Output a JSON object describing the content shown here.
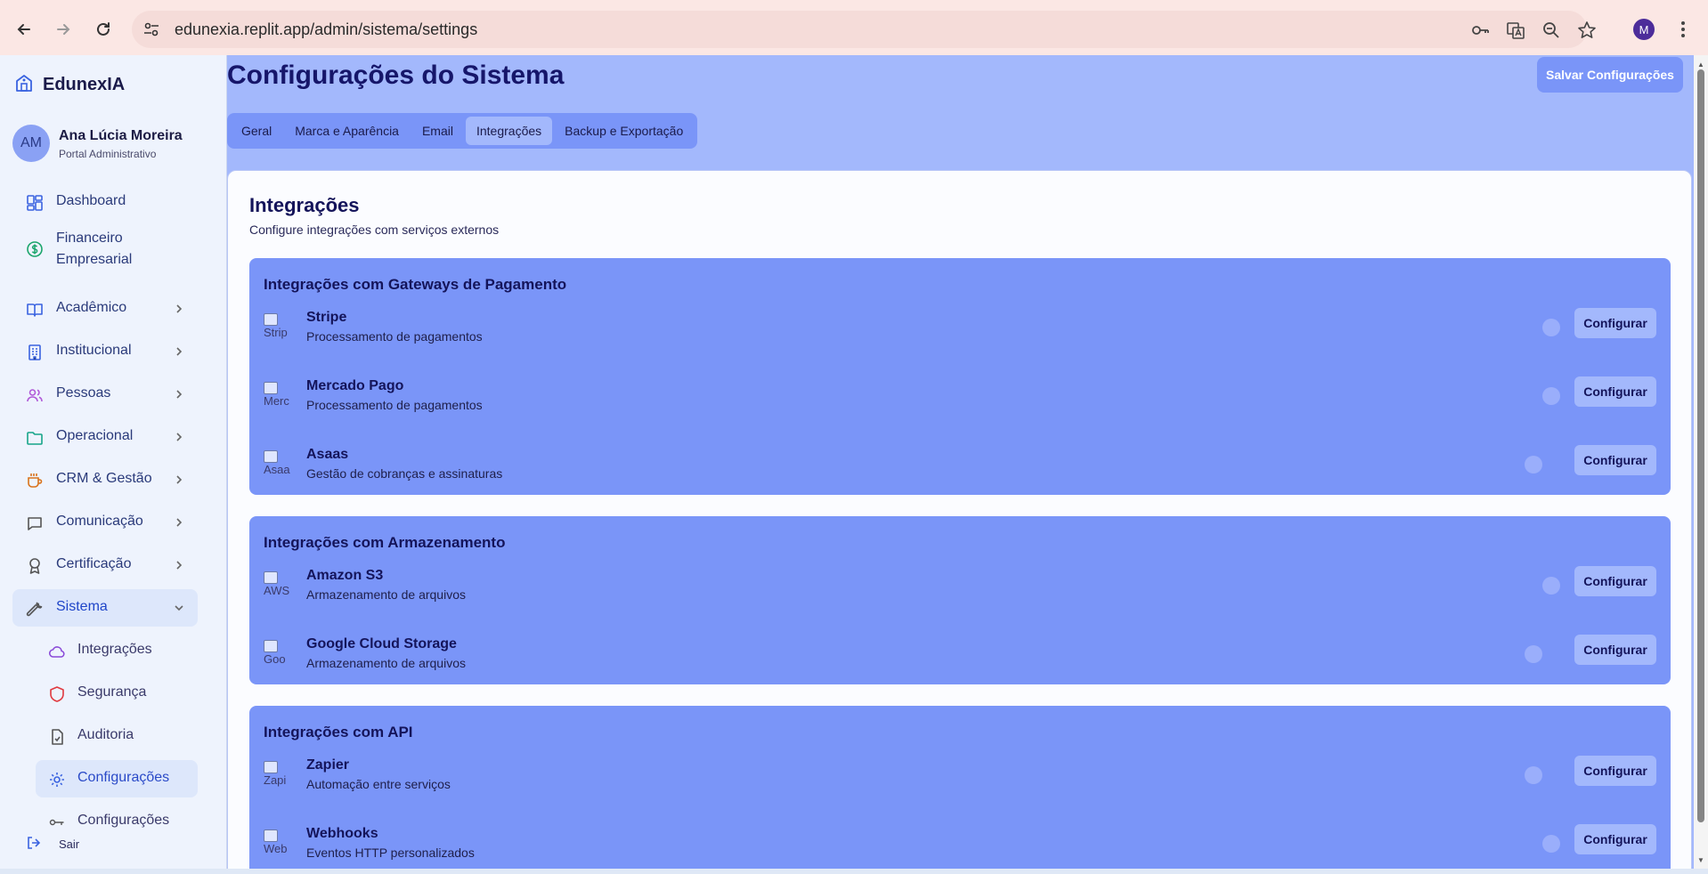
{
  "browser": {
    "url": "edunexia.replit.app/admin/sistema/settings",
    "profile_initial": "M"
  },
  "sidebar": {
    "brand": "EdunexIA",
    "user": {
      "initials": "AM",
      "name": "Ana Lúcia Moreira",
      "role": "Portal Administrativo"
    },
    "items": [
      {
        "label": "Dashboard",
        "icon": "dashboard-icon"
      },
      {
        "label": "Financeiro",
        "label2": "Empresarial",
        "icon": "dollar-icon"
      },
      {
        "label": "Acadêmico",
        "icon": "book-icon"
      },
      {
        "label": "Institucional",
        "icon": "building-icon"
      },
      {
        "label": "Pessoas",
        "icon": "users-icon"
      },
      {
        "label": "Operacional",
        "icon": "folder-icon"
      },
      {
        "label": "CRM & Gestão",
        "icon": "coffee-icon"
      },
      {
        "label": "Comunicação",
        "icon": "message-icon"
      },
      {
        "label": "Certificação",
        "icon": "award-icon"
      },
      {
        "label": "Sistema",
        "icon": "wrench-icon"
      }
    ],
    "sub_items": [
      {
        "label": "Integrações",
        "icon": "cloud-icon"
      },
      {
        "label": "Segurança",
        "icon": "shield-icon"
      },
      {
        "label": "Auditoria",
        "icon": "file-check-icon"
      },
      {
        "label": "Configurações",
        "icon": "settings-icon"
      },
      {
        "label": "Configurações",
        "icon": "key-icon"
      }
    ],
    "logout": "Sair"
  },
  "main": {
    "title": "Configurações do Sistema",
    "save_button": "Salvar Configurações",
    "tabs": [
      "Geral",
      "Marca e Aparência",
      "Email",
      "Integrações",
      "Backup e Exportação"
    ],
    "active_tab": "Integrações",
    "section_title": "Integrações",
    "section_subtitle": "Configure integrações com serviços externos",
    "configure_label": "Configurar",
    "groups": [
      {
        "title": "Integrações com Gateways de Pagamento",
        "services": [
          {
            "name": "Stripe",
            "desc": "Processamento de pagamentos",
            "alt": "Strip"
          },
          {
            "name": "Mercado Pago",
            "desc": "Processamento de pagamentos",
            "alt": "Merc"
          },
          {
            "name": "Asaas",
            "desc": "Gestão de cobranças e assinaturas",
            "alt": "Asaa"
          }
        ]
      },
      {
        "title": "Integrações com Armazenamento",
        "services": [
          {
            "name": "Amazon S3",
            "desc": "Armazenamento de arquivos",
            "alt": "AWS"
          },
          {
            "name": "Google Cloud Storage",
            "desc": "Armazenamento de arquivos",
            "alt": "Goo"
          }
        ]
      },
      {
        "title": "Integrações com API",
        "services": [
          {
            "name": "Zapier",
            "desc": "Automação entre serviços",
            "alt": "Zapi"
          },
          {
            "name": "Webhooks",
            "desc": "Eventos HTTP personalizados",
            "alt": "Web"
          }
        ]
      }
    ]
  },
  "colors": {
    "accent": "#7a95f8",
    "main_bg": "#a3b8fc",
    "title": "#16166a",
    "sidebar_bg": "#eef3fd"
  }
}
